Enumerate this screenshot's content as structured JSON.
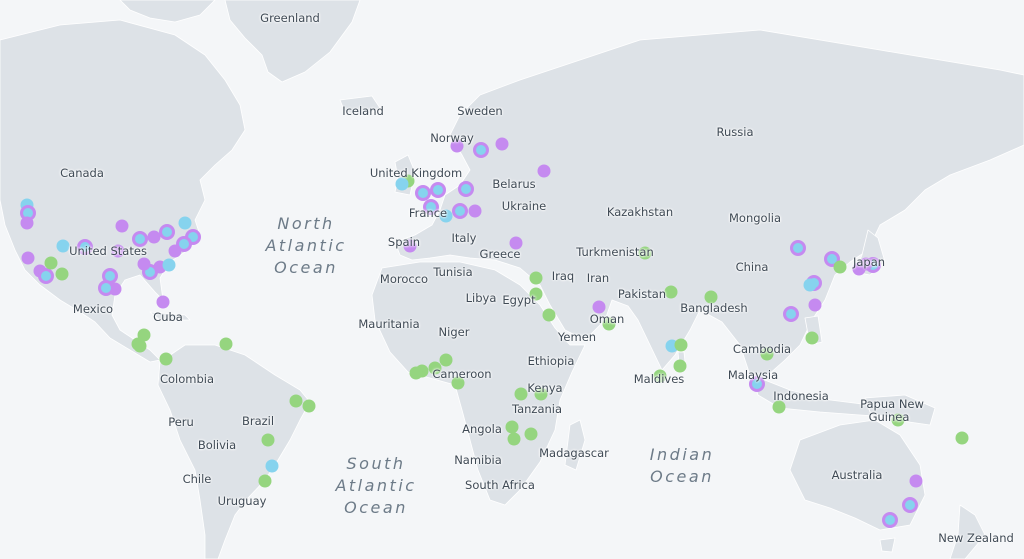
{
  "labels": {
    "greenland": "Greenland",
    "iceland": "Iceland",
    "sweden": "Sweden",
    "norway": "Norway",
    "russia": "Russia",
    "canada": "Canada",
    "belarus": "Belarus",
    "united_kingdom": "United Kingdom",
    "ukraine": "Ukraine",
    "france": "France",
    "kazakhstan": "Kazakhstan",
    "mongolia": "Mongolia",
    "italy": "Italy",
    "united_states": "United States",
    "spain": "Spain",
    "greece": "Greece",
    "turkmenistan": "Turkmenistan",
    "japan": "Japan",
    "china": "China",
    "tunisia": "Tunisia",
    "iraq": "Iraq",
    "iran": "Iran",
    "morocco": "Morocco",
    "libya": "Libya",
    "egypt": "Egypt",
    "pakistan": "Pakistan",
    "bangladesh": "Bangladesh",
    "mexico": "Mexico",
    "oman": "Oman",
    "cuba": "Cuba",
    "mauritania": "Mauritania",
    "niger": "Niger",
    "yemen": "Yemen",
    "cambodia": "Cambodia",
    "ethiopia": "Ethiopia",
    "cameroon": "Cameroon",
    "colombia": "Colombia",
    "maldives": "Maldives",
    "malaysia": "Malaysia",
    "kenya": "Kenya",
    "indonesia": "Indonesia",
    "papua_new_guinea_1": "Papua New",
    "papua_new_guinea_2": "Guinea",
    "tanzania": "Tanzania",
    "peru": "Peru",
    "brazil": "Brazil",
    "angola": "Angola",
    "bolivia": "Bolivia",
    "madagascar": "Madagascar",
    "namibia": "Namibia",
    "chile": "Chile",
    "south_africa": "South Africa",
    "australia": "Australia",
    "uruguay": "Uruguay",
    "new_zealand": "New Zealand"
  },
  "oceans": {
    "north_atlantic": [
      "North",
      "Atlantic",
      "Ocean"
    ],
    "south_atlantic": [
      "South",
      "Atlantic",
      "Ocean"
    ],
    "indian": [
      "Indian",
      "Ocean"
    ]
  },
  "colors": {
    "water": "#f4f6f8",
    "land": "#dde2e7",
    "purple": "#c58af0",
    "blue": "#86d3ee",
    "green": "#95d57f"
  }
}
